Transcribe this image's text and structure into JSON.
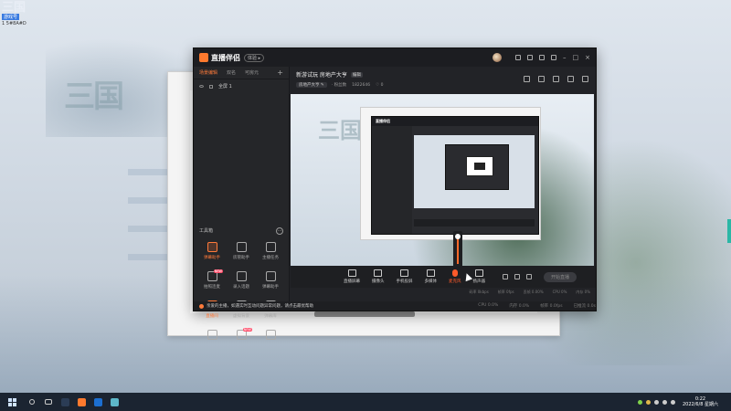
{
  "watermark": {
    "big": "三国",
    "sub": "游戏号",
    "id": "1 5#8A#D"
  },
  "app": {
    "brand": "直播伴侣",
    "beta_label": "体验 ▸",
    "left_tabs": [
      "场景编辑",
      "双名",
      "可房元"
    ],
    "tab_add": "+",
    "scene_label": "全屏 1",
    "toolbox_title": "工具箱",
    "toolbox_more": "···",
    "tools": [
      {
        "label": "弹幕助手",
        "hot": true,
        "badge": ""
      },
      {
        "label": "房管助手",
        "hot": false,
        "badge": ""
      },
      {
        "label": "主播任务",
        "hot": false,
        "badge": ""
      },
      {
        "label": "拍照连麦",
        "hot": false,
        "badge": "NEW"
      },
      {
        "label": "录入话题",
        "hot": false,
        "badge": ""
      },
      {
        "label": "弹幕助手",
        "hot": false,
        "badge": ""
      },
      {
        "label": "直播间",
        "hot": true,
        "badge": ""
      },
      {
        "label": "虚拟背景",
        "hot": false,
        "badge": ""
      },
      {
        "label": "弹幕库",
        "hot": false,
        "badge": ""
      },
      {
        "label": "",
        "hot": false,
        "badge": ""
      },
      {
        "label": "",
        "hot": false,
        "badge": "NEW"
      },
      {
        "label": "",
        "hot": false,
        "badge": ""
      }
    ],
    "notice": "亲爱的主播，如遇实时互动问题异常问题，请点击最优帮助",
    "status": [
      "CPU 0.0%",
      "内存 0.0%",
      "帧率 0.0fps",
      "已推流 0.0s"
    ],
    "room_title": "新游试玩 房地产大亨",
    "room_edit": "编辑",
    "room_category": "房地产大亨 ✎",
    "room_follow": "· 粉丝数",
    "room_id": "1822646",
    "room_likes": "♡ 0",
    "volume_value": "100",
    "controls": [
      {
        "label": "直播屏幕",
        "active": false
      },
      {
        "label": "摄像头",
        "active": false
      },
      {
        "label": "手机投屏",
        "active": false
      },
      {
        "label": "多媒体",
        "active": false
      },
      {
        "label": "麦克风",
        "active": true
      },
      {
        "label": "扬声器",
        "active": false
      }
    ],
    "start_button": "开始直播",
    "stats": [
      "码率 0kbps",
      "帧率 0fps",
      "丢帧 0.00%",
      "CPU 0%",
      "内存 0%"
    ]
  },
  "taskbar": {
    "time": "0:22",
    "date": "2022/6/8 星期六",
    "accent": "#1b2431"
  }
}
